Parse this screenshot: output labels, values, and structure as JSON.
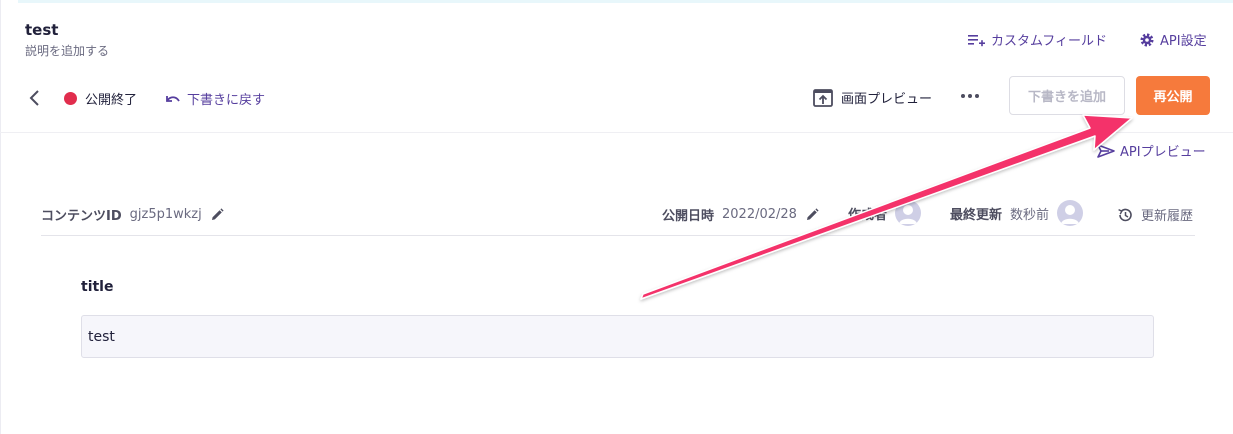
{
  "header": {
    "title": "test",
    "description": "説明を追加する",
    "custom_field_label": "カスタムフィールド",
    "api_settings_label": "API設定"
  },
  "toolbar": {
    "status_label": "公開終了",
    "status_color": "#e12d4d",
    "revert_label": "下書きに戻す",
    "preview_label": "画面プレビュー",
    "add_draft_label": "下書きを追加",
    "republish_label": "再公開",
    "republish_color": "#f67a3c"
  },
  "api_preview_label": "APIプレビュー",
  "meta": {
    "content_id_label": "コンテンツID",
    "content_id_value": "gjz5p1wkzj",
    "published_label": "公開日時",
    "published_value": "2022/02/28",
    "author_label": "作成者",
    "updated_label": "最終更新",
    "updated_value": "数秒前",
    "history_label": "更新履歴"
  },
  "field": {
    "label": "title",
    "value": "test"
  },
  "annotation": {
    "arrow_color": "#f4336b"
  }
}
